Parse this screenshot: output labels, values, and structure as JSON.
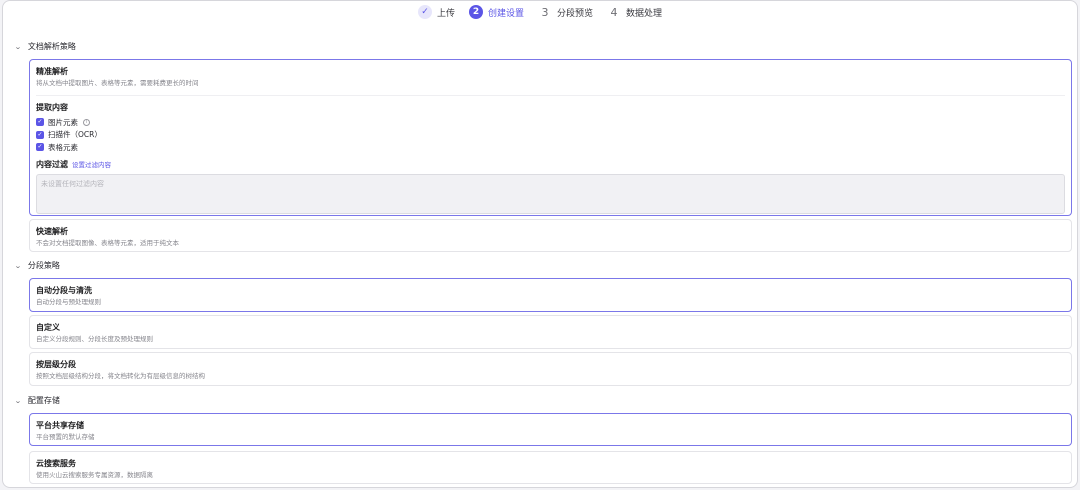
{
  "steps": [
    {
      "badge": "✓",
      "label": "上传"
    },
    {
      "badge": "2",
      "label": "创建设置"
    },
    {
      "badge": "3",
      "label": "分段预览"
    },
    {
      "badge": "4",
      "label": "数据处理"
    }
  ],
  "parsing": {
    "header": "文档解析策略",
    "precise": {
      "title": "精准解析",
      "desc": "将从文档中提取图片、表格等元素，需要耗费更长的时间",
      "extract_title": "提取内容",
      "options": [
        "图片元素",
        "扫描件（OCR）",
        "表格元素"
      ],
      "filter_label": "内容过滤",
      "filter_link": "设置过滤内容",
      "filter_placeholder": "未设置任何过滤内容"
    },
    "fast": {
      "title": "快速解析",
      "desc": "不会对文档提取图像、表格等元素，适用于纯文本"
    }
  },
  "segmentation": {
    "header": "分段策略",
    "options": [
      {
        "title": "自动分段与清洗",
        "desc": "自动分段与预处理规则"
      },
      {
        "title": "自定义",
        "desc": "自定义分段规则、分段长度及预处理规则"
      },
      {
        "title": "按层级分段",
        "desc": "按照文档层级结构分段，将文档转化为有层级信息的树结构"
      }
    ]
  },
  "storage": {
    "header": "配置存储",
    "options": [
      {
        "title": "平台共享存储",
        "desc": "平台预置的默认存储"
      },
      {
        "title": "云搜索服务",
        "desc": "使用火山云搜索服务专属资源，数据隔离"
      }
    ]
  },
  "colors": {
    "accent": "#5b55e6",
    "selected_border": "#7b77e9"
  }
}
